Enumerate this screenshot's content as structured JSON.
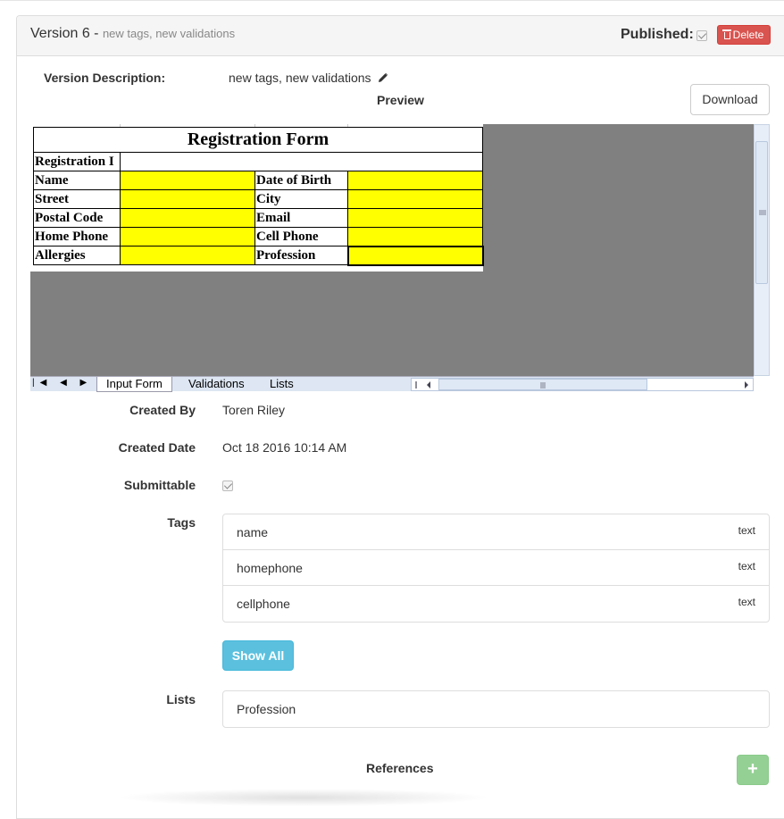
{
  "version": {
    "title": "Version 6 -",
    "subtitle": "new tags, new validations",
    "published_label": "Published:",
    "published": true,
    "delete_label": "Delete"
  },
  "description": {
    "label": "Version Description:",
    "value": "new tags, new validations"
  },
  "preview": {
    "label": "Preview",
    "download_label": "Download",
    "sheet": {
      "title": "Registration Form",
      "row_label": "Registration I",
      "rows": [
        [
          "Name",
          "Date of Birth"
        ],
        [
          "Street",
          "City"
        ],
        [
          "Postal Code",
          "Email"
        ],
        [
          "Home Phone",
          "Cell Phone"
        ],
        [
          "Allergies",
          "Profession"
        ]
      ],
      "fill_color": "#ffff00",
      "tabs": [
        "Input Form",
        "Validations",
        "Lists"
      ],
      "nav_buttons": "|◀ ◀ ▶ ▶|"
    }
  },
  "details": {
    "created_by_label": "Created By",
    "created_by": "Toren Riley",
    "created_date_label": "Created Date",
    "created_date": "Oct 18 2016 10:14 AM",
    "submittable_label": "Submittable",
    "submittable": true,
    "tags_label": "Tags",
    "tags": [
      {
        "name": "name",
        "type": "text"
      },
      {
        "name": "homephone",
        "type": "text"
      },
      {
        "name": "cellphone",
        "type": "text"
      }
    ],
    "show_all_label": "Show All",
    "lists_label": "Lists",
    "lists": [
      "Profession"
    ],
    "references_label": "References",
    "add_label": "+"
  },
  "colors": {
    "delete": "#d9534f",
    "info": "#5bc0de",
    "success": "#5cb85c",
    "sheet_bg": "#808080"
  }
}
